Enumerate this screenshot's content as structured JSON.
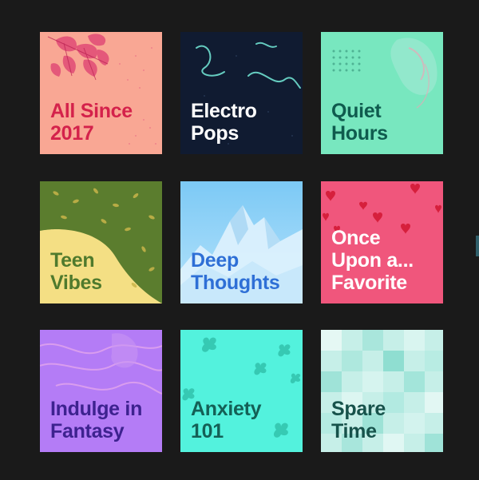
{
  "playlists": [
    {
      "id": "all-since-2017",
      "lines": [
        "All Since",
        "2017"
      ],
      "bg": "#f9a794",
      "text_color": "#d4224b"
    },
    {
      "id": "electro-pops",
      "lines": [
        "Electro",
        "Pops"
      ],
      "bg": "#14203a",
      "text_color": "#ffffff"
    },
    {
      "id": "quiet-hours",
      "lines": [
        "Quiet",
        "Hours"
      ],
      "bg": "#78e7bf",
      "text_color": "#0f5b4e"
    },
    {
      "id": "teen-vibes",
      "lines": [
        "Teen",
        "Vibes"
      ],
      "bg": "#f4df84",
      "text_color": "#4f7a2d"
    },
    {
      "id": "deep-thoughts",
      "lines": [
        "Deep",
        "Thoughts"
      ],
      "bg": "#86d2f7",
      "text_color": "#2e6fd6"
    },
    {
      "id": "once-upon-a-favorite",
      "lines": [
        "Once",
        "Upon a...",
        "Favorite"
      ],
      "bg": "#f0567c",
      "text_color": "#ffffff"
    },
    {
      "id": "indulge-in-fantasy",
      "lines": [
        "Indulge in",
        "Fantasy"
      ],
      "bg": "#b47cf6",
      "text_color": "#3d228f"
    },
    {
      "id": "anxiety-101",
      "lines": [
        "Anxiety",
        "101"
      ],
      "bg": "#53f2dd",
      "text_color": "#146056"
    },
    {
      "id": "spare-time",
      "lines": [
        "Spare",
        "Time"
      ],
      "bg": "#c6efe8",
      "text_color": "#17524b"
    }
  ]
}
